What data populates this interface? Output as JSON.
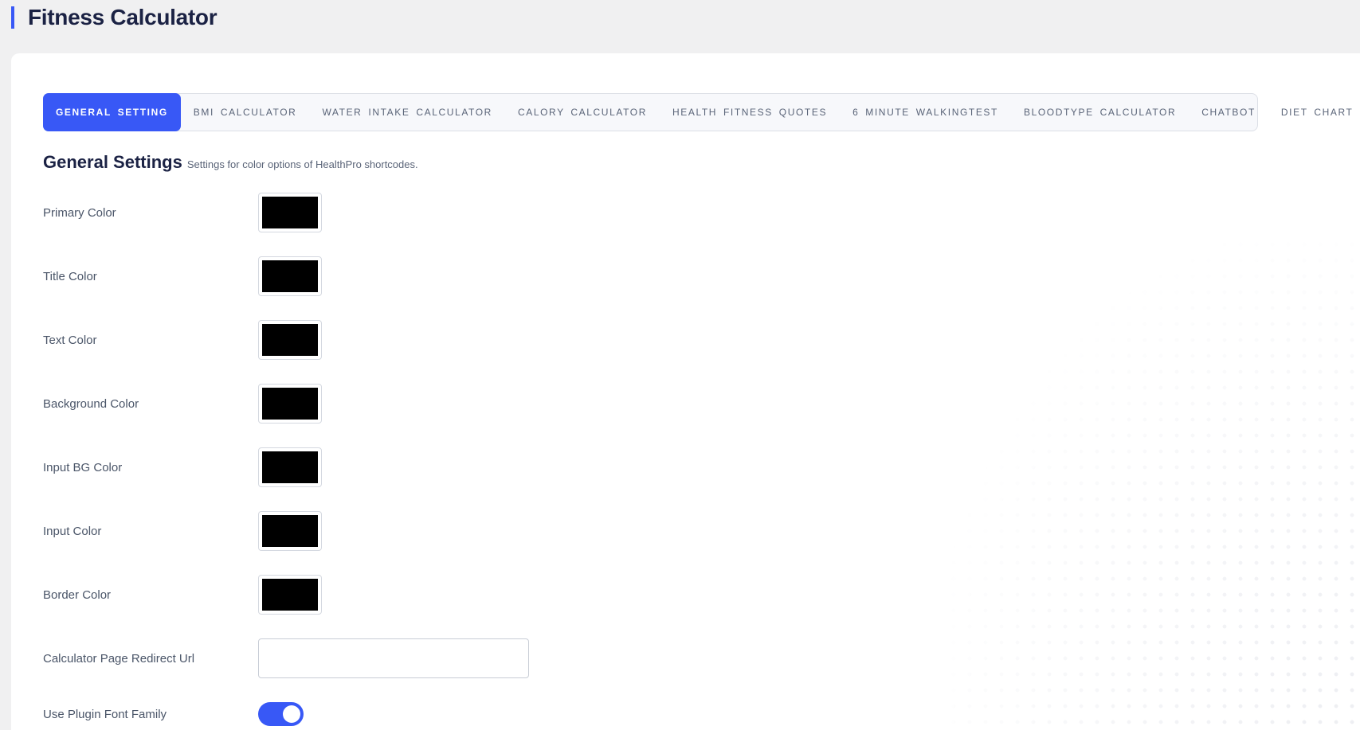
{
  "page": {
    "title": "Fitness Calculator"
  },
  "tabs": [
    {
      "label": "GENERAL SETTING",
      "active": true
    },
    {
      "label": "BMI CALCULATOR",
      "active": false
    },
    {
      "label": "WATER INTAKE CALCULATOR",
      "active": false
    },
    {
      "label": "CALORY CALCULATOR",
      "active": false
    },
    {
      "label": "HEALTH FITNESS QUOTES",
      "active": false
    },
    {
      "label": "6 MINUTE WALKINGTEST",
      "active": false
    },
    {
      "label": "BLOODTYPE CALCULATOR",
      "active": false
    },
    {
      "label": "CHATBOT",
      "active": false
    },
    {
      "label": "DIET CHART",
      "active": false
    }
  ],
  "section": {
    "title": "General Settings",
    "description": "Settings for color options of HealthPro shortcodes."
  },
  "fields": {
    "primary_color": {
      "label": "Primary Color",
      "value": "#000000"
    },
    "title_color": {
      "label": "Title Color",
      "value": "#000000"
    },
    "text_color": {
      "label": "Text Color",
      "value": "#000000"
    },
    "background_color": {
      "label": "Background Color",
      "value": "#000000"
    },
    "input_bg_color": {
      "label": "Input BG Color",
      "value": "#000000"
    },
    "input_color": {
      "label": "Input Color",
      "value": "#000000"
    },
    "border_color": {
      "label": "Border Color",
      "value": "#000000"
    },
    "redirect_url": {
      "label": "Calculator Page Redirect Url",
      "value": ""
    },
    "plugin_font": {
      "label": "Use Plugin Font Family",
      "enabled": true
    }
  },
  "colors": {
    "accent": "#3858f6",
    "background": "#f0f0f1",
    "card": "#ffffff"
  }
}
